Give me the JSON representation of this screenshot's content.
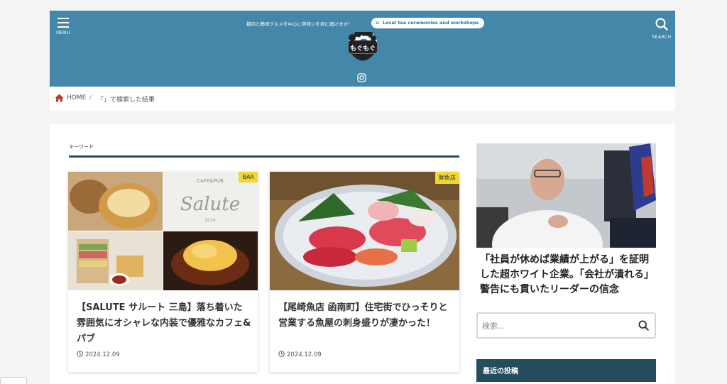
{
  "header": {
    "menu_label": "MENU",
    "search_label": "SEARCH",
    "tagline": "都内と静岡グルメを中心に美味いを君に届けます！",
    "pill_label": "Local tea ceremonies and workshops",
    "logo_text": "もぐもぐ"
  },
  "breadcrumb": {
    "home": "HOME",
    "separator": "/",
    "current": "「」で検索した結果"
  },
  "main": {
    "section_label": "キーワード",
    "posts": [
      {
        "category": "BAR",
        "title": "【SALUTE サルート 三島】落ち着いた雰囲気にオシャレな内装で優雅なカフェ&パブ",
        "date": "2024.12.09",
        "thumb_sign_top": "CAFE&PUB",
        "thumb_sign_main": "Salute",
        "thumb_sign_year": "2024"
      },
      {
        "category": "鮮魚店",
        "title": "【尾崎魚店 函南町】住宅街でひっそりと営業する魚屋の刺身盛りが凄かった！",
        "date": "2024.12.09"
      }
    ]
  },
  "sidebar": {
    "ad_text": "「社員が休めば業績が上がる」を証明した超ホワイト企業。「会社が潰れる」警告にも貫いたリーダーの信念",
    "search_placeholder": "検索...",
    "recent_heading": "最近の投稿"
  },
  "colors": {
    "header_bg": "#4587a8",
    "accent_dark": "#254d5e",
    "category_badge": "#f1d733",
    "home_icon": "#c0392b"
  }
}
